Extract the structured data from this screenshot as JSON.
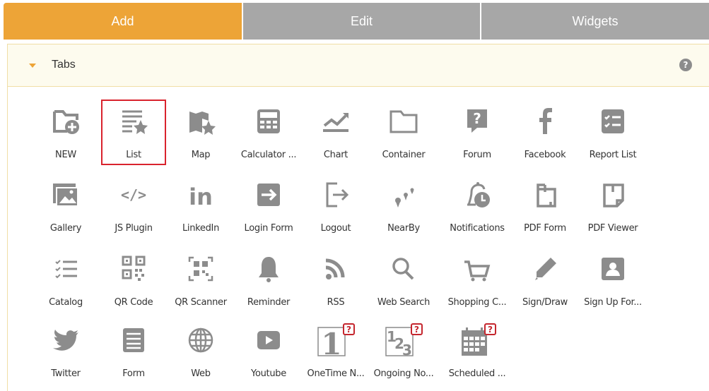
{
  "tabs": [
    {
      "label": "Add",
      "active": true
    },
    {
      "label": "Edit",
      "active": false
    },
    {
      "label": "Widgets",
      "active": false
    }
  ],
  "section": {
    "title": "Tabs",
    "help_icon": "question-circle-icon"
  },
  "colors": {
    "accent": "#eda437",
    "tab_inactive": "#a7a7a7",
    "icon": "#8c8c8c",
    "selected_border": "#d9232d"
  },
  "widgets": [
    {
      "label": "NEW",
      "icon": "folder-plus-icon"
    },
    {
      "label": "List",
      "icon": "list-star-icon",
      "selected": true
    },
    {
      "label": "Map",
      "icon": "map-star-icon"
    },
    {
      "label": "Calculator ...",
      "icon": "calculator-icon"
    },
    {
      "label": "Chart",
      "icon": "chart-icon"
    },
    {
      "label": "Container",
      "icon": "folder-icon"
    },
    {
      "label": "Forum",
      "icon": "question-box-icon"
    },
    {
      "label": "Facebook",
      "icon": "facebook-icon"
    },
    {
      "label": "Report List",
      "icon": "report-list-icon"
    },
    {
      "label": "Gallery",
      "icon": "gallery-icon"
    },
    {
      "label": "JS Plugin",
      "icon": "code-icon"
    },
    {
      "label": "LinkedIn",
      "icon": "linkedin-icon"
    },
    {
      "label": "Login Form",
      "icon": "login-icon"
    },
    {
      "label": "Logout",
      "icon": "logout-icon"
    },
    {
      "label": "NearBy",
      "icon": "nearby-icon"
    },
    {
      "label": "Notifications",
      "icon": "notification-clock-icon"
    },
    {
      "label": "PDF Form",
      "icon": "pdf-form-icon"
    },
    {
      "label": "PDF Viewer",
      "icon": "pdf-viewer-icon"
    },
    {
      "label": "Catalog",
      "icon": "catalog-icon"
    },
    {
      "label": "QR Code",
      "icon": "qr-code-icon"
    },
    {
      "label": "QR Scanner",
      "icon": "qr-scanner-icon"
    },
    {
      "label": "Reminder",
      "icon": "bell-icon"
    },
    {
      "label": "RSS",
      "icon": "rss-icon"
    },
    {
      "label": "Web Search",
      "icon": "search-icon"
    },
    {
      "label": "Shopping C...",
      "icon": "cart-icon"
    },
    {
      "label": "Sign/Draw",
      "icon": "pencil-icon"
    },
    {
      "label": "Sign Up For...",
      "icon": "user-card-icon"
    },
    {
      "label": "Twitter",
      "icon": "twitter-icon"
    },
    {
      "label": "Form",
      "icon": "form-icon"
    },
    {
      "label": "Web",
      "icon": "globe-icon"
    },
    {
      "label": "Youtube",
      "icon": "youtube-icon"
    },
    {
      "label": "OneTime N...",
      "icon": "onetime-notification-icon"
    },
    {
      "label": "Ongoing No...",
      "icon": "ongoing-notification-icon"
    },
    {
      "label": "Scheduled ...",
      "icon": "scheduled-notification-icon"
    }
  ]
}
